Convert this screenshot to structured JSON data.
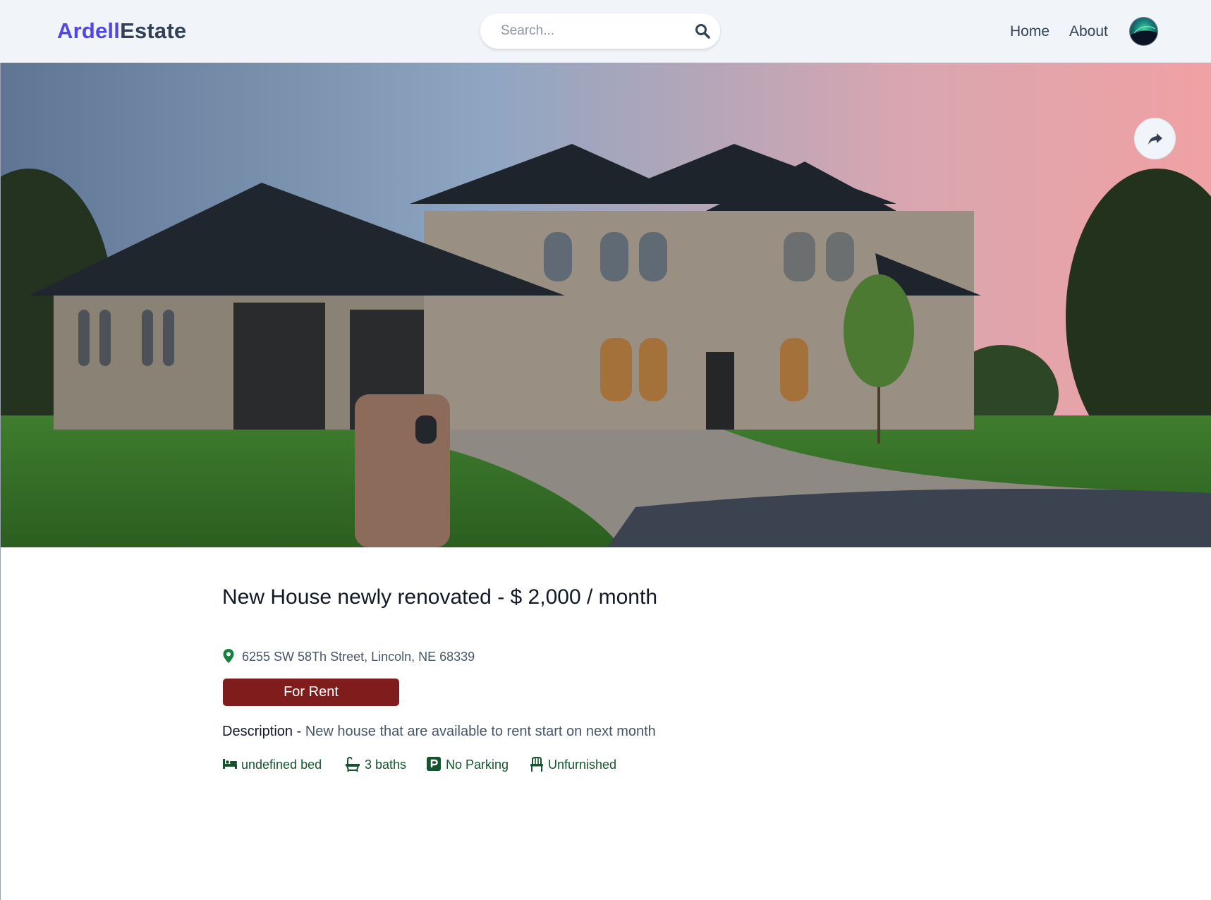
{
  "header": {
    "brand_part1": "Ardell",
    "brand_part2": "Estate",
    "search_placeholder": "Search...",
    "nav": {
      "home": "Home",
      "about": "About"
    }
  },
  "listing": {
    "title": "New House newly renovated - $ 2,000 / month",
    "address": "6255 SW 58Th Street, Lincoln, NE 68339",
    "status": "For Rent",
    "description_label": "Description",
    "description_separator": " - ",
    "description": "New house that are available to rent start on next month",
    "features": {
      "beds": "undefined bed",
      "baths": "3 baths",
      "parking": "No Parking",
      "furnished": "Unfurnished"
    }
  },
  "colors": {
    "brand_primary": "#4f46e5",
    "brand_secondary": "#334155",
    "status_badge": "#7f1d1d",
    "feature_text": "#14532d",
    "pin_icon": "#15803d"
  },
  "icons": {
    "search": "search-icon",
    "share": "share-icon",
    "location": "map-pin-icon",
    "beds": "bed-icon",
    "baths": "bath-icon",
    "parking": "parking-icon",
    "furnished": "chair-icon"
  }
}
